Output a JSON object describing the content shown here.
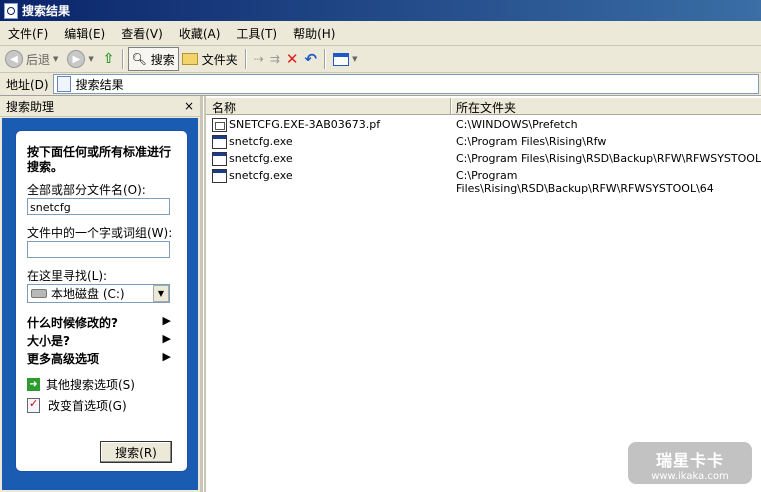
{
  "window": {
    "title": "搜索结果"
  },
  "menu": [
    "文件(F)",
    "编辑(E)",
    "查看(V)",
    "收藏(A)",
    "工具(T)",
    "帮助(H)"
  ],
  "toolbar": {
    "back": "后退",
    "search": "搜索",
    "folders": "文件夹"
  },
  "address": {
    "label": "地址(D)",
    "value": "搜索结果"
  },
  "assistant": {
    "title": "搜索助理",
    "close": "×",
    "hint": "按下面任何或所有标准进行搜索。",
    "name_label": "全部或部分文件名(O):",
    "name_value": "snetcfg",
    "word_label": "文件中的一个字或词组(W):",
    "word_value": "",
    "lookin_label": "在这里寻找(L):",
    "lookin_value": "本地磁盘 (C:)",
    "when": "什么时候修改的?",
    "size": "大小是?",
    "more": "更多高级选项",
    "other": "其他搜索选项(S)",
    "prefs": "改变首选项(G)",
    "search_btn": "搜索(R)"
  },
  "results": {
    "columns": {
      "name": "名称",
      "folder": "所在文件夹"
    },
    "rows": [
      {
        "name": "SNETCFG.EXE-3AB03673.pf",
        "folder": "C:\\WINDOWS\\Prefetch",
        "icon": "prefetch-file-icon"
      },
      {
        "name": "snetcfg.exe",
        "folder": "C:\\Program Files\\Rising\\Rfw",
        "icon": "exe-file-icon"
      },
      {
        "name": "snetcfg.exe",
        "folder": "C:\\Program Files\\Rising\\RSD\\Backup\\RFW\\RFWSYSTOOL",
        "icon": "exe-file-icon"
      },
      {
        "name": "snetcfg.exe",
        "folder": "C:\\Program Files\\Rising\\RSD\\Backup\\RFW\\RFWSYSTOOL\\64",
        "icon": "exe-file-icon"
      }
    ]
  },
  "watermark": {
    "brand": "瑞星卡卡",
    "url": "www.ikaka.com"
  }
}
